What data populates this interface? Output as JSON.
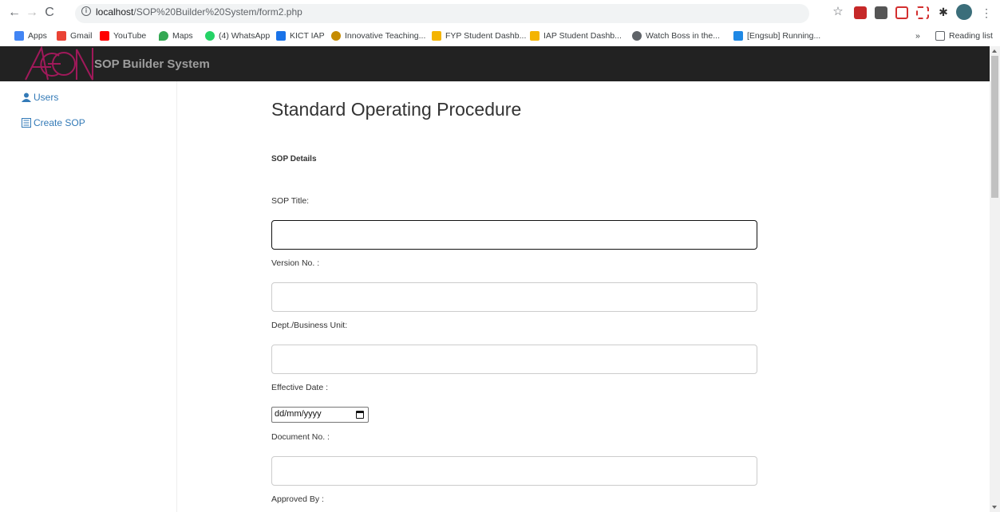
{
  "browser": {
    "url_host": "localhost",
    "url_path": "/SOP%20Builder%20System/form2.php",
    "reading_list": "Reading list",
    "overflow": "»"
  },
  "bookmarks": [
    {
      "label": "Apps",
      "color": "#4285f4"
    },
    {
      "label": "Gmail",
      "color": "#ea4335"
    },
    {
      "label": "YouTube",
      "color": "#ff0000"
    },
    {
      "label": "Maps",
      "color": "#34a853"
    },
    {
      "label": "(4) WhatsApp",
      "color": "#25d366"
    },
    {
      "label": "KICT IAP",
      "color": "#1a73e8"
    },
    {
      "label": "Innovative Teaching...",
      "color": "#c58b00"
    },
    {
      "label": "FYP Student Dashb...",
      "color": "#f4b400"
    },
    {
      "label": "IAP Student Dashb...",
      "color": "#f4b400"
    },
    {
      "label": "Watch Boss in the...",
      "color": "#5f6368"
    },
    {
      "label": "[Engsub] Running...",
      "color": "#1e88e5"
    }
  ],
  "app": {
    "brand": "SOP Builder System",
    "sidebar": [
      {
        "label": "Users",
        "icon": "user-icon"
      },
      {
        "label": "Create SOP",
        "icon": "list-icon"
      }
    ],
    "title": "Standard Operating Procedure",
    "section": "SOP Details",
    "fields": {
      "sop_title": {
        "label": "SOP Title:",
        "value": ""
      },
      "version": {
        "label": "Version No. :",
        "value": ""
      },
      "dept": {
        "label": "Dept./Business Unit:",
        "value": ""
      },
      "effective_date": {
        "label": "Effective Date :",
        "placeholder": "dd/mm/yyyy"
      },
      "document_no": {
        "label": "Document No. :",
        "value": ""
      },
      "approved_by": {
        "label": "Approved By :"
      }
    }
  }
}
